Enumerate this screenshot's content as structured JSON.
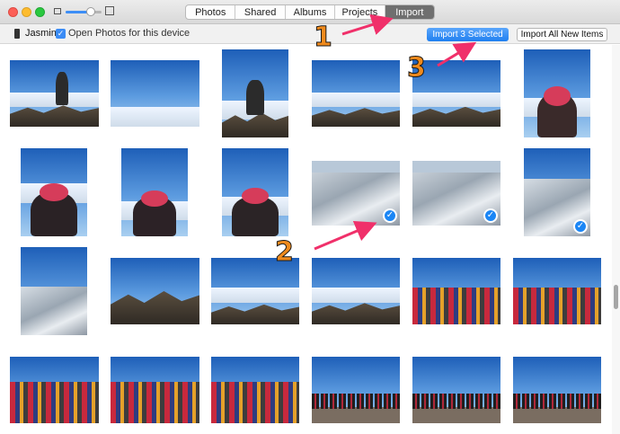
{
  "tabs": [
    {
      "label": "Photos"
    },
    {
      "label": "Shared"
    },
    {
      "label": "Albums"
    },
    {
      "label": "Projects"
    },
    {
      "label": "Import",
      "active": true
    }
  ],
  "device": {
    "name": "Jasmin",
    "open_photos_label": "Open Photos for this device",
    "open_photos_checked": true
  },
  "buttons": {
    "import_selected": "Import 3 Selected",
    "import_all": "Import All New Items"
  },
  "thumbnail_size_slider": {
    "value": 0.7
  },
  "annotations": [
    "1",
    "2",
    "3"
  ],
  "colors": {
    "accent": "#1f7ff0",
    "annotation": "#f08a1c",
    "arrow": "#f0306a"
  },
  "photos_selected": [
    7,
    8,
    11
  ]
}
